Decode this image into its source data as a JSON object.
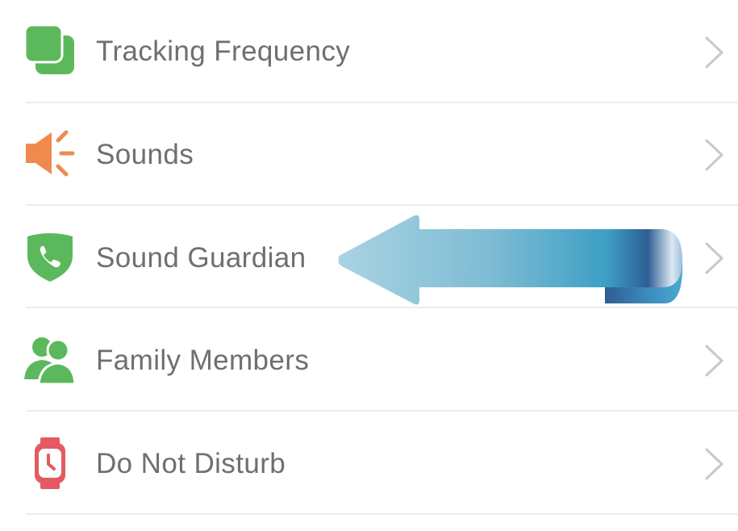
{
  "menu": {
    "items": [
      {
        "label": "Tracking Frequency",
        "icon": "tracking-frequency-icon",
        "icon_color": "#5cb85c"
      },
      {
        "label": "Sounds",
        "icon": "speaker-icon",
        "icon_color": "#ef8a4f"
      },
      {
        "label": "Sound Guardian",
        "icon": "shield-phone-icon",
        "icon_color": "#5cb85c"
      },
      {
        "label": "Family Members",
        "icon": "family-members-icon",
        "icon_color": "#5cb85c"
      },
      {
        "label": "Do Not Disturb",
        "icon": "watch-icon",
        "icon_color": "#e45a61"
      }
    ],
    "chevron_icon": "chevron-right-icon"
  },
  "annotation": {
    "icon": "callout-arrow-left",
    "colors": [
      "#8cc6dc",
      "#3d9fc5",
      "#2f5e95"
    ]
  }
}
